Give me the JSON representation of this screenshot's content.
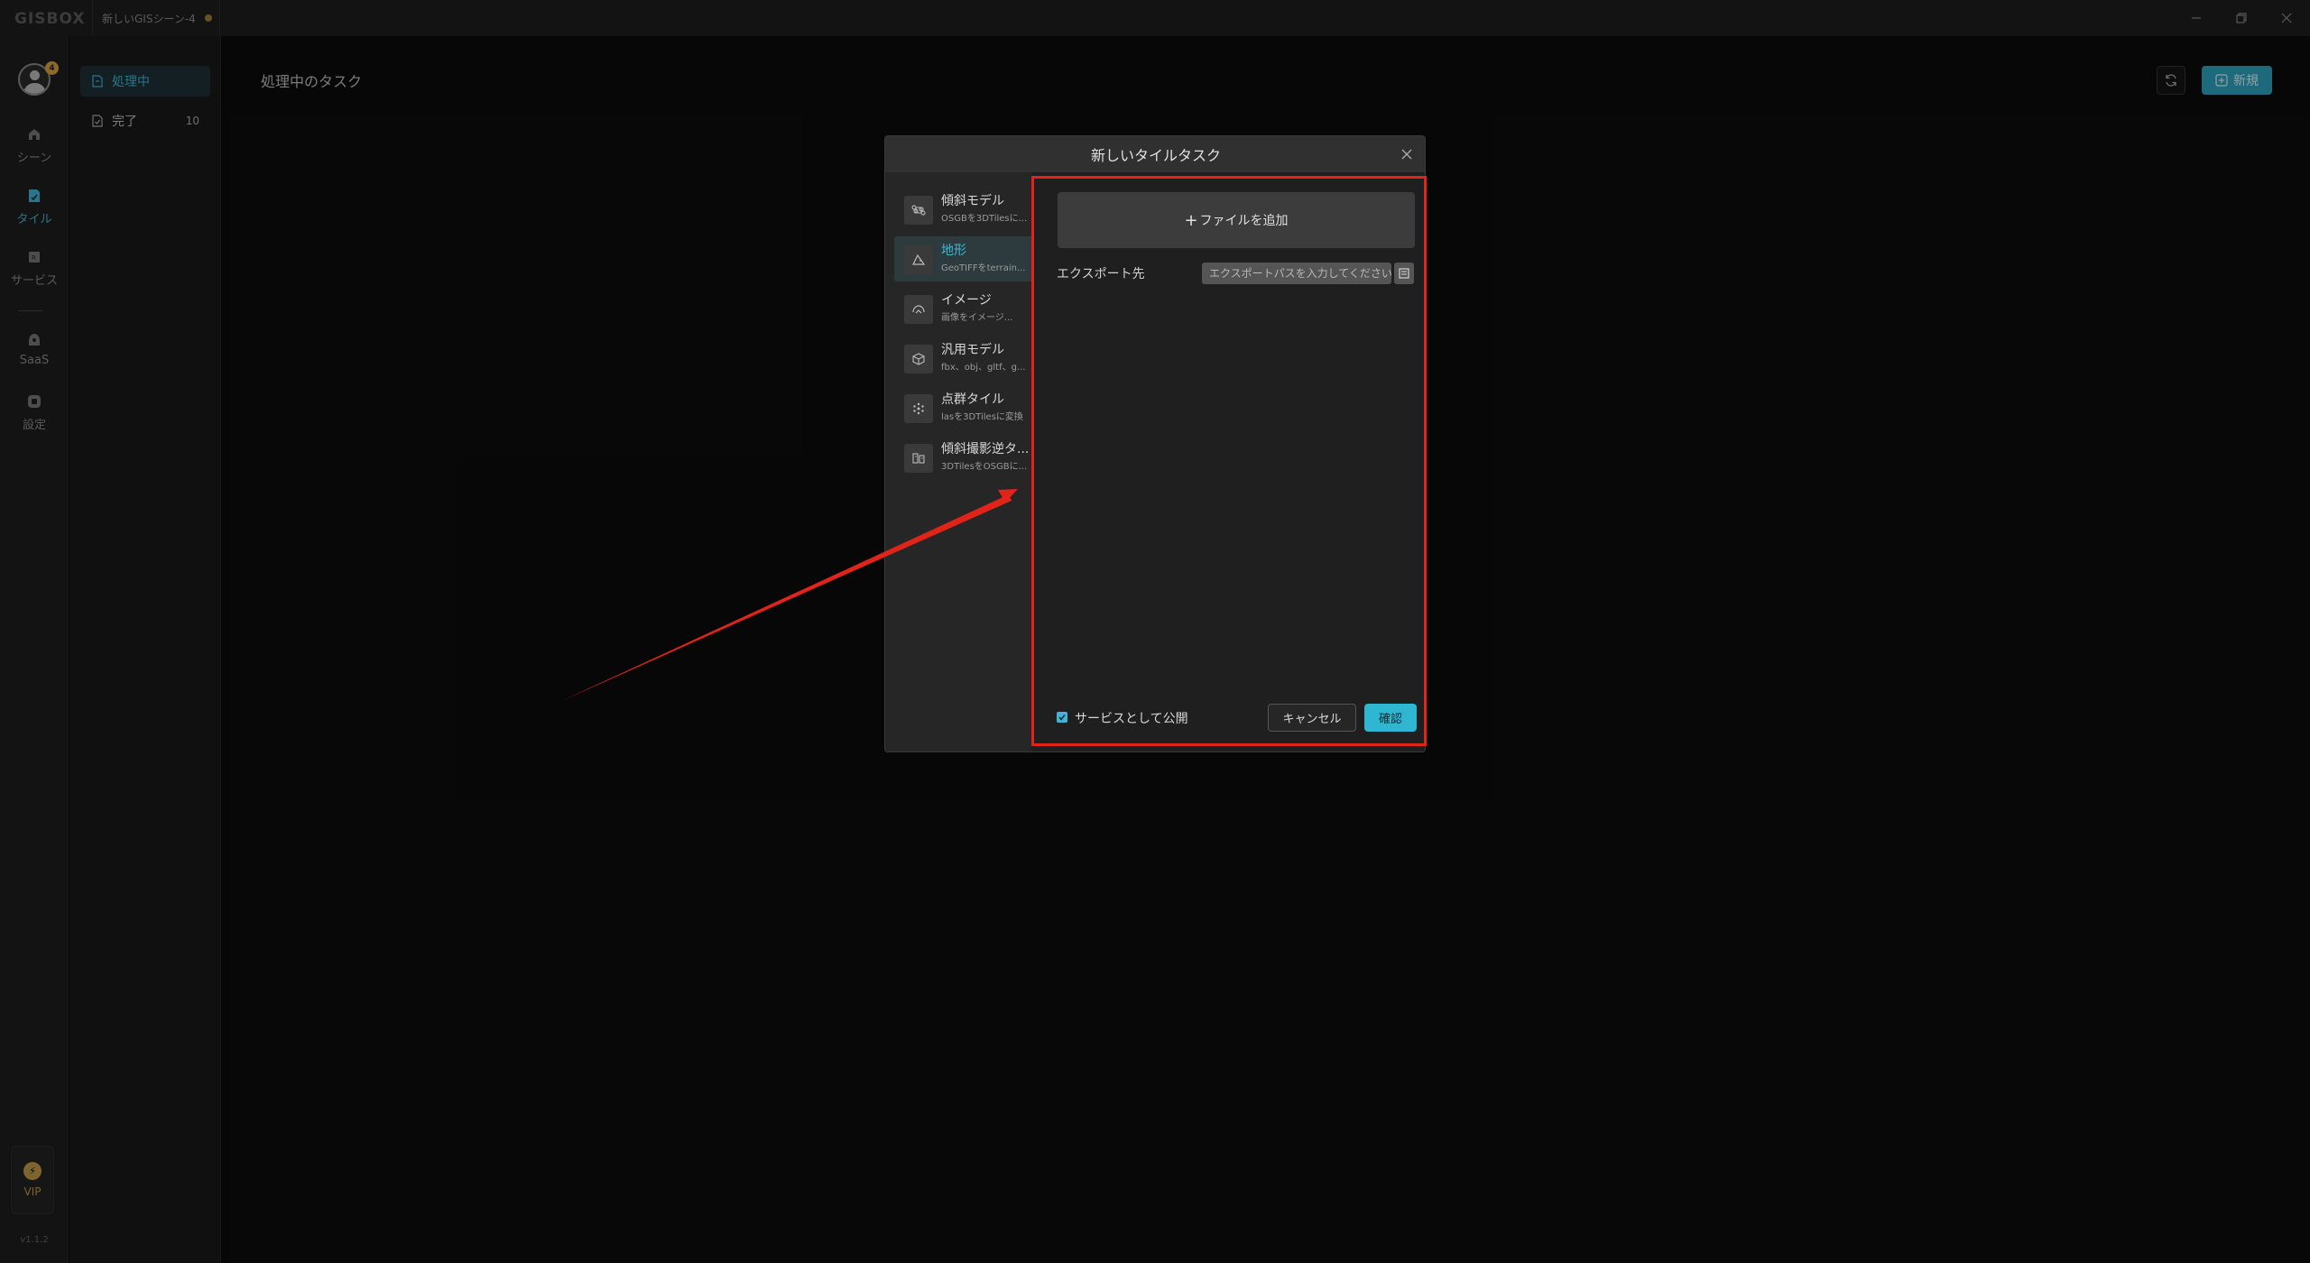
{
  "app": {
    "logo": "GISBOX",
    "scene_tab": "新しいGISシーン-4"
  },
  "window_controls": [
    "minimize-icon",
    "restore-icon",
    "close-icon"
  ],
  "rail": {
    "avatar_badge": "4",
    "items": [
      {
        "label": "シーン",
        "icon": "scene-icon"
      },
      {
        "label": "タイル",
        "icon": "tile-icon",
        "active": true
      },
      {
        "label": "サービス",
        "icon": "service-icon"
      },
      {
        "label": "SaaS",
        "icon": "saas-icon"
      },
      {
        "label": "設定",
        "icon": "settings-icon"
      }
    ],
    "vip_label": "VIP",
    "version": "v1.1.2"
  },
  "subnav": {
    "items": [
      {
        "label": "処理中",
        "active": true
      },
      {
        "label": "完了",
        "count": "10"
      }
    ]
  },
  "main": {
    "title": "処理中のタスク",
    "new_button": "新規"
  },
  "modal": {
    "title": "新しいタイルタスク",
    "types": [
      {
        "title": "傾斜モデル",
        "desc": "OSGBを3DTilesに..."
      },
      {
        "title": "地形",
        "desc": "GeoTIFFをterrain...",
        "active": true
      },
      {
        "title": "イメージ",
        "desc": "画像をイメージ..."
      },
      {
        "title": "汎用モデル",
        "desc": "fbx、obj、gltf、g..."
      },
      {
        "title": "点群タイル",
        "desc": "lasを3DTilesに変換"
      },
      {
        "title": "傾斜撮影逆タ...",
        "desc": "3DTilesをOSGBに..."
      }
    ],
    "add_file": "ファイルを追加",
    "export_label": "エクスポート先",
    "export_placeholder": "エクスポートパスを入力してください",
    "publish_label": "サービスとして公開",
    "publish_checked": true,
    "cancel": "キャンセル",
    "confirm": "確認"
  },
  "colors": {
    "accent": "#3fb6d8",
    "primary_button": "#2fa3bf",
    "annotation": "#e0241a",
    "vip": "#c29a48"
  }
}
